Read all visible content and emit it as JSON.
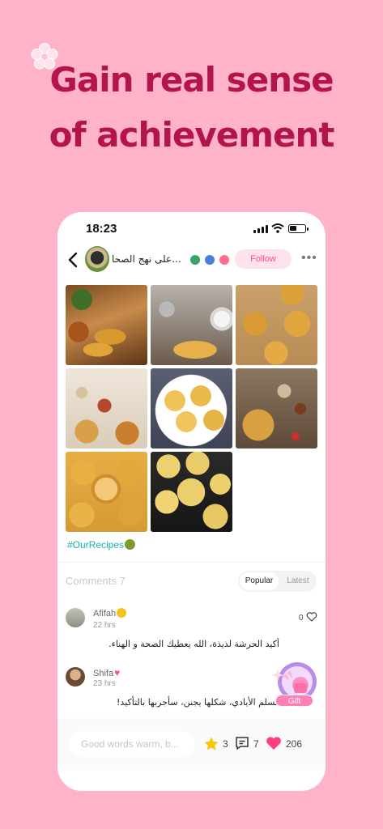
{
  "banner": {
    "headline_line1": "Gain real sense",
    "headline_line2": "of achievement",
    "accent_color": "#b3144a",
    "background_color": "#ffb3c9"
  },
  "status_bar": {
    "time": "18:23"
  },
  "post_header": {
    "group_name": "على نهج الصحا...",
    "follow_label": "Follow",
    "more_label": "•••"
  },
  "photos": [
    {
      "name": "food-photo-1"
    },
    {
      "name": "food-photo-2"
    },
    {
      "name": "food-photo-3"
    },
    {
      "name": "food-photo-4"
    },
    {
      "name": "food-photo-5"
    },
    {
      "name": "food-photo-6"
    },
    {
      "name": "food-photo-7"
    },
    {
      "name": "food-photo-8"
    }
  ],
  "hashtag": "#OurRecipes",
  "comments_section": {
    "title": "Comments 7",
    "sort_popular": "Popular",
    "sort_latest": "Latest"
  },
  "comments": [
    {
      "user": "Afifah",
      "time": "22 hrs",
      "text": "أكيد الحرشة لذيذة، الله يعطيك الصحة و الهناء.",
      "likes": "0"
    },
    {
      "user": "Shifa",
      "time": "23 hrs",
      "text": "تسلم الأيادي، شكلها يجنن، سأجربها بالتأكيد!"
    }
  ],
  "gift": {
    "label": "Gift"
  },
  "bottom_bar": {
    "input_placeholder": "Good words warm, b...",
    "stars": "3",
    "comments": "7",
    "likes": "206"
  },
  "icons": {
    "back": "chevron-left-icon",
    "star": "star-icon",
    "comment": "comment-icon",
    "like": "heart-icon",
    "signal": "signal-icon",
    "wifi": "wifi-icon",
    "battery": "battery-icon"
  },
  "colors": {
    "follow_text": "#ff4f85",
    "hashtag": "#16b3a3",
    "like": "#ff3d7f",
    "star": "#f7c600"
  }
}
